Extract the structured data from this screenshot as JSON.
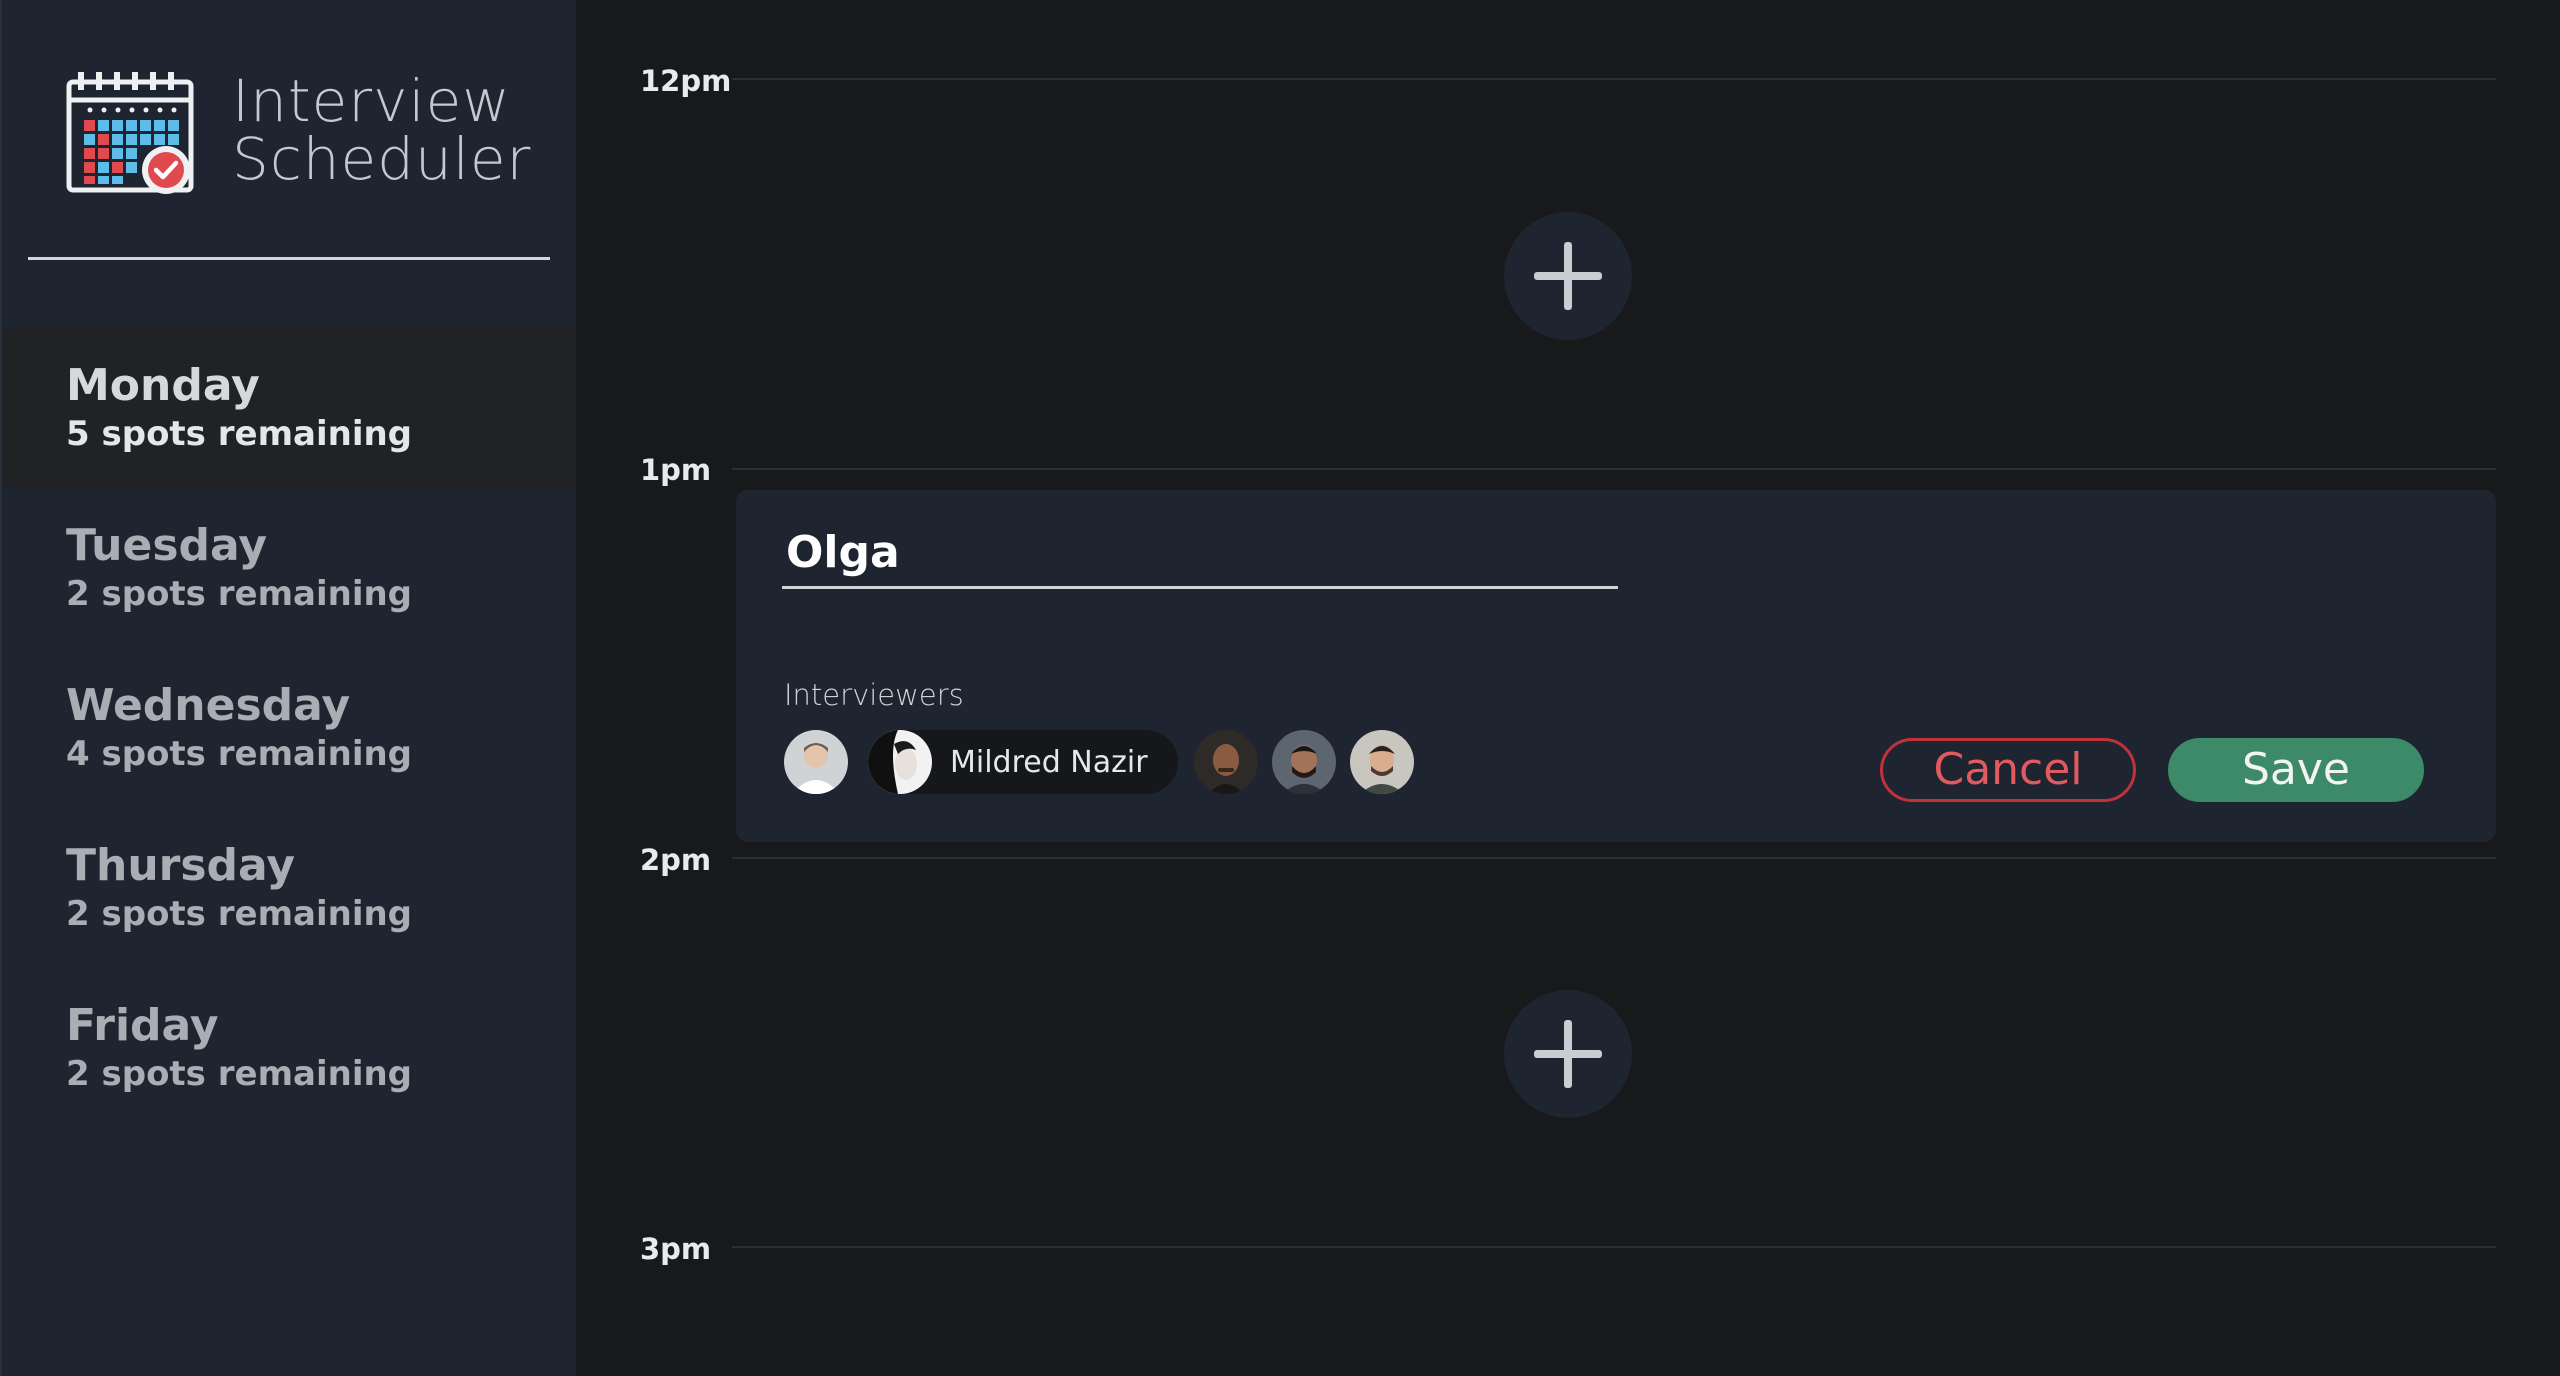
{
  "app": {
    "title": "Interview Scheduler",
    "logo_icon": "calendar-check-icon"
  },
  "sidebar": {
    "days": [
      {
        "name": "Monday",
        "spots": "5 spots remaining",
        "selected": true
      },
      {
        "name": "Tuesday",
        "spots": "2 spots remaining",
        "selected": false
      },
      {
        "name": "Wednesday",
        "spots": "4 spots remaining",
        "selected": false
      },
      {
        "name": "Thursday",
        "spots": "2 spots remaining",
        "selected": false
      },
      {
        "name": "Friday",
        "spots": "2 spots remaining",
        "selected": false
      }
    ]
  },
  "schedule": {
    "times": [
      "12pm",
      "1pm",
      "2pm",
      "3pm"
    ],
    "add_icon": "plus-icon"
  },
  "form": {
    "student_name": "Olga",
    "interviewers_label": "Interviewers",
    "selected_interviewer": "Mildred Nazir",
    "cancel_label": "Cancel",
    "save_label": "Save"
  },
  "colors": {
    "sidebar_bg": "#1e2530",
    "main_bg": "#18191b",
    "cancel": "#c0323a",
    "save": "#3c8a68"
  }
}
